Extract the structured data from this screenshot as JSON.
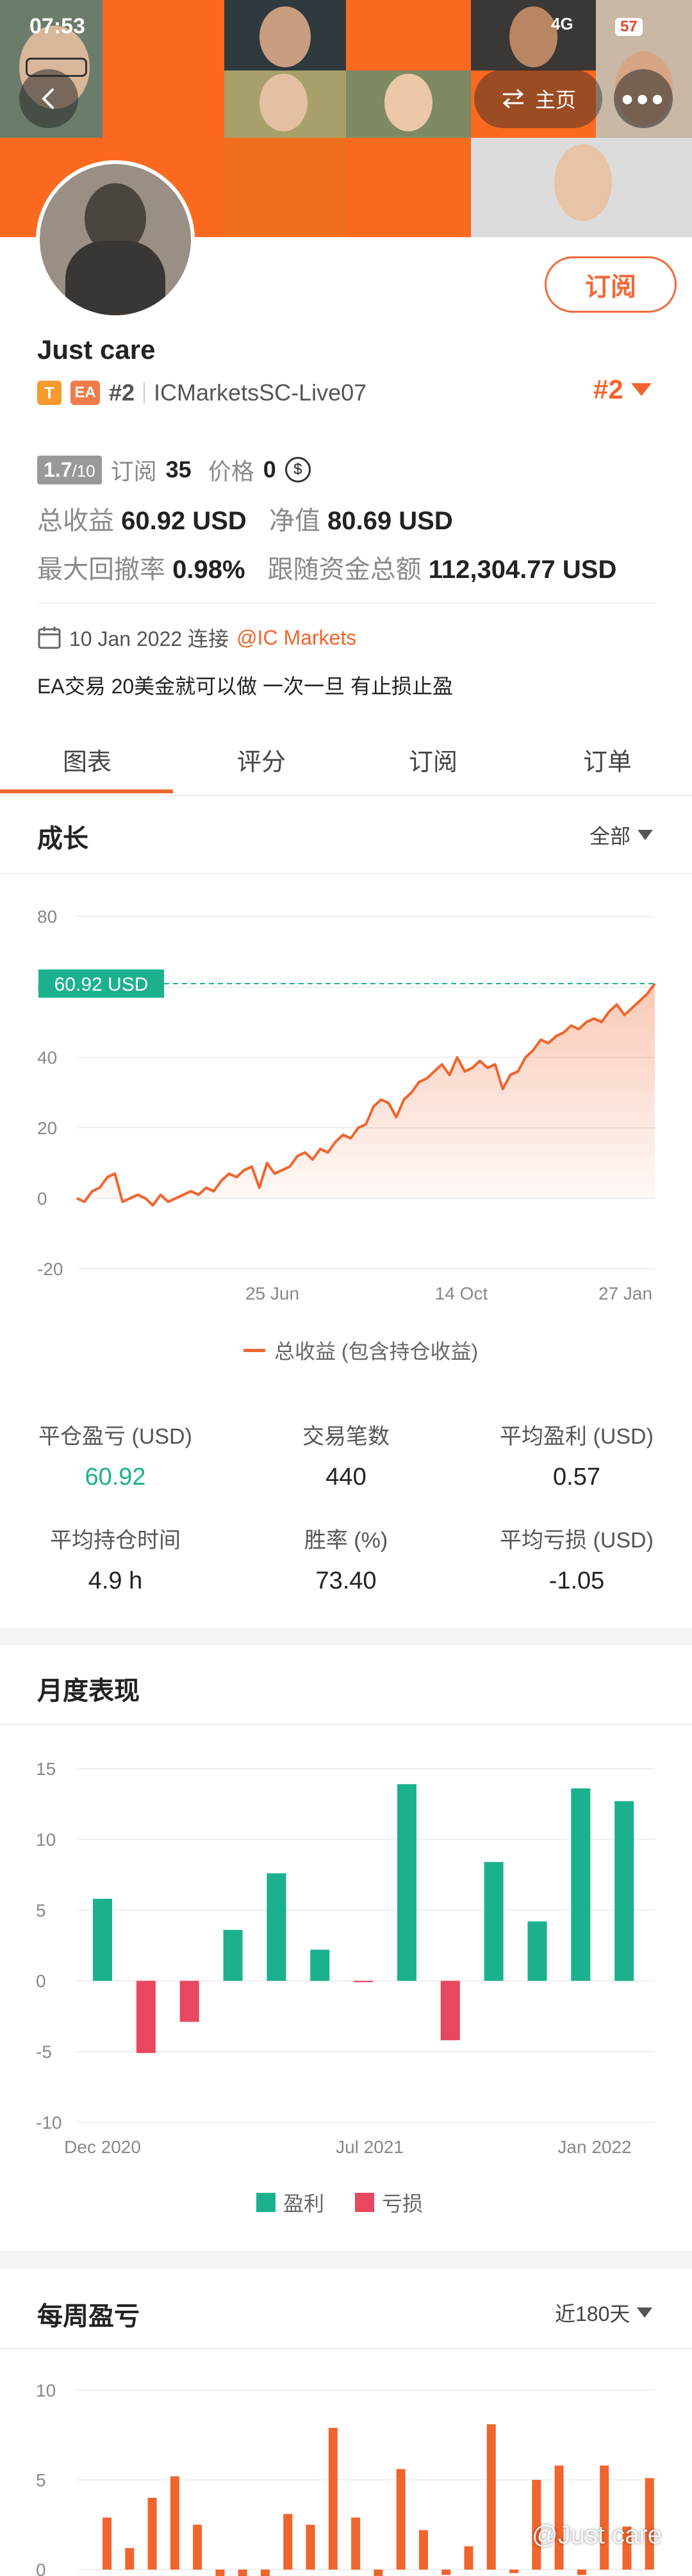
{
  "status_bar": {
    "time": "07:53",
    "network": "4G",
    "battery": "57"
  },
  "header": {
    "home_label": "主页"
  },
  "profile": {
    "name": "Just care",
    "badge_t": "T",
    "badge_ea": "EA",
    "rank": "#2",
    "server": "ICMarketsSC-Live07",
    "rank_right": "#2",
    "subscribe_label": "订阅"
  },
  "stats_top": {
    "rating": "1.7",
    "rating_max": "/10",
    "subscribers_label": "订阅",
    "subscribers": "35",
    "price_label": "价格",
    "price": "0",
    "total_profit_label": "总收益",
    "total_profit": "60.92 USD",
    "equity_label": "净值",
    "equity": "80.69 USD",
    "drawdown_label": "最大回撤率",
    "drawdown": "0.98%",
    "follow_funds_label": "跟随资金总额",
    "follow_funds": "112,304.77 USD"
  },
  "connection": {
    "date_text": "10 Jan 2022 连接",
    "broker": "@IC Markets"
  },
  "description": "EA交易 20美金就可以做 一次一旦 有止损止盈",
  "tabs": [
    "图表",
    "评分",
    "订阅",
    "订单"
  ],
  "growth": {
    "title": "成长",
    "filter": "全部",
    "legend": "总收益 (包含持仓收益)",
    "value_tag": "60.92 USD"
  },
  "summary": {
    "items": [
      {
        "label": "平仓盈亏 (USD)",
        "value": "60.92"
      },
      {
        "label": "交易笔数",
        "value": "440"
      },
      {
        "label": "平均盈利 (USD)",
        "value": "0.57"
      },
      {
        "label": "平均持仓时间",
        "value": "4.9 h"
      },
      {
        "label": "胜率 (%)",
        "value": "73.40"
      },
      {
        "label": "平均亏损 (USD)",
        "value": "-1.05"
      }
    ]
  },
  "monthly": {
    "title": "月度表现",
    "legend_profit": "盈利",
    "legend_loss": "亏损"
  },
  "weekly": {
    "title": "每周盈亏",
    "filter": "近180天"
  },
  "watermark": "@Just care",
  "colors": {
    "orange": "#f0652e",
    "teal": "#1bb18e",
    "red": "#e8485f",
    "header": "#fb6a1f"
  },
  "chart_data": [
    {
      "type": "area",
      "title": "",
      "ylim": [
        -20,
        80
      ],
      "yticks": [
        80,
        60,
        40,
        20,
        0,
        -20
      ],
      "xticks": [
        "25 Jun",
        "14 Oct",
        "27 Jan"
      ],
      "series": [
        {
          "name": "总收益 (包含持仓收益)",
          "values": [
            0,
            -1,
            2,
            3,
            6,
            7,
            -1,
            0,
            1,
            0,
            -2,
            1,
            -1,
            0,
            1,
            2,
            1,
            3,
            2,
            5,
            7,
            6,
            8,
            9,
            3,
            10,
            7,
            8,
            9,
            12,
            13,
            11,
            14,
            13,
            16,
            18,
            17,
            20,
            21,
            26,
            28,
            27,
            23,
            28,
            30,
            33,
            34,
            36,
            38,
            35,
            40,
            36,
            37,
            39,
            37,
            38,
            31,
            35,
            36,
            40,
            42,
            45,
            44,
            46,
            47,
            49,
            48,
            50,
            51,
            50,
            53,
            55,
            52,
            54,
            56,
            58,
            60.92
          ]
        }
      ]
    },
    {
      "type": "bar",
      "ylim": [
        -10,
        15
      ],
      "yticks": [
        15,
        10,
        5,
        0,
        -5,
        -10
      ],
      "xticks": [
        "Dec 2020",
        "Jul 2021",
        "Jan 2022"
      ],
      "series": [
        {
          "name": "盈利 / 亏损",
          "values": [
            5.8,
            -5.1,
            -2.9,
            3.6,
            7.6,
            2.2,
            -0.1,
            13.9,
            -4.2,
            8.4,
            4.2,
            13.6,
            12.7
          ]
        }
      ]
    },
    {
      "type": "bar",
      "ylim": [
        0,
        10
      ],
      "yticks": [
        10,
        5,
        0
      ],
      "series": [
        {
          "name": "weekly",
          "values": [
            2.9,
            1.2,
            4.0,
            5.2,
            2.5,
            -0.4,
            -0.4,
            -0.4,
            3.1,
            2.5,
            7.9,
            2.9,
            -0.4,
            5.6,
            2.2,
            -0.3,
            1.3,
            8.1,
            -0.2,
            5.0,
            5.8,
            -0.3,
            5.8,
            2.4,
            5.1
          ]
        }
      ]
    }
  ]
}
